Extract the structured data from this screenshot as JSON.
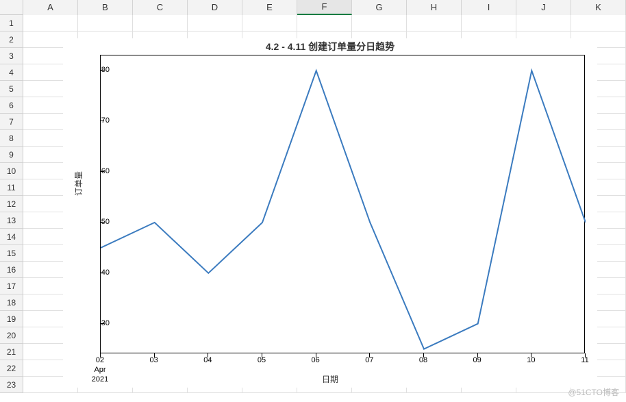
{
  "spreadsheet": {
    "columns": [
      "A",
      "B",
      "C",
      "D",
      "E",
      "F",
      "G",
      "H",
      "I",
      "J",
      "K"
    ],
    "selected_column": "F",
    "rows": [
      1,
      2,
      3,
      4,
      5,
      6,
      7,
      8,
      9,
      10,
      11,
      12,
      13,
      14,
      15,
      16,
      17,
      18,
      19,
      20,
      21,
      22,
      23
    ]
  },
  "chart_data": {
    "type": "line",
    "title": "4.2 - 4.11 创建订单量分日趋势",
    "xlabel": "日期",
    "ylabel": "订单量",
    "ylim": [
      24,
      83
    ],
    "yticks": [
      30,
      40,
      50,
      60,
      70,
      80
    ],
    "xtick_labels": [
      "02\nApr\n2021",
      "03",
      "04",
      "05",
      "06",
      "07",
      "08",
      "09",
      "10",
      "11"
    ],
    "x": [
      "2021-04-02",
      "2021-04-03",
      "2021-04-04",
      "2021-04-05",
      "2021-04-06",
      "2021-04-07",
      "2021-04-08",
      "2021-04-09",
      "2021-04-10",
      "2021-04-11"
    ],
    "values": [
      45,
      50,
      40,
      50,
      80,
      50,
      25,
      30,
      80,
      50
    ]
  },
  "watermark": "@51CTO博客"
}
